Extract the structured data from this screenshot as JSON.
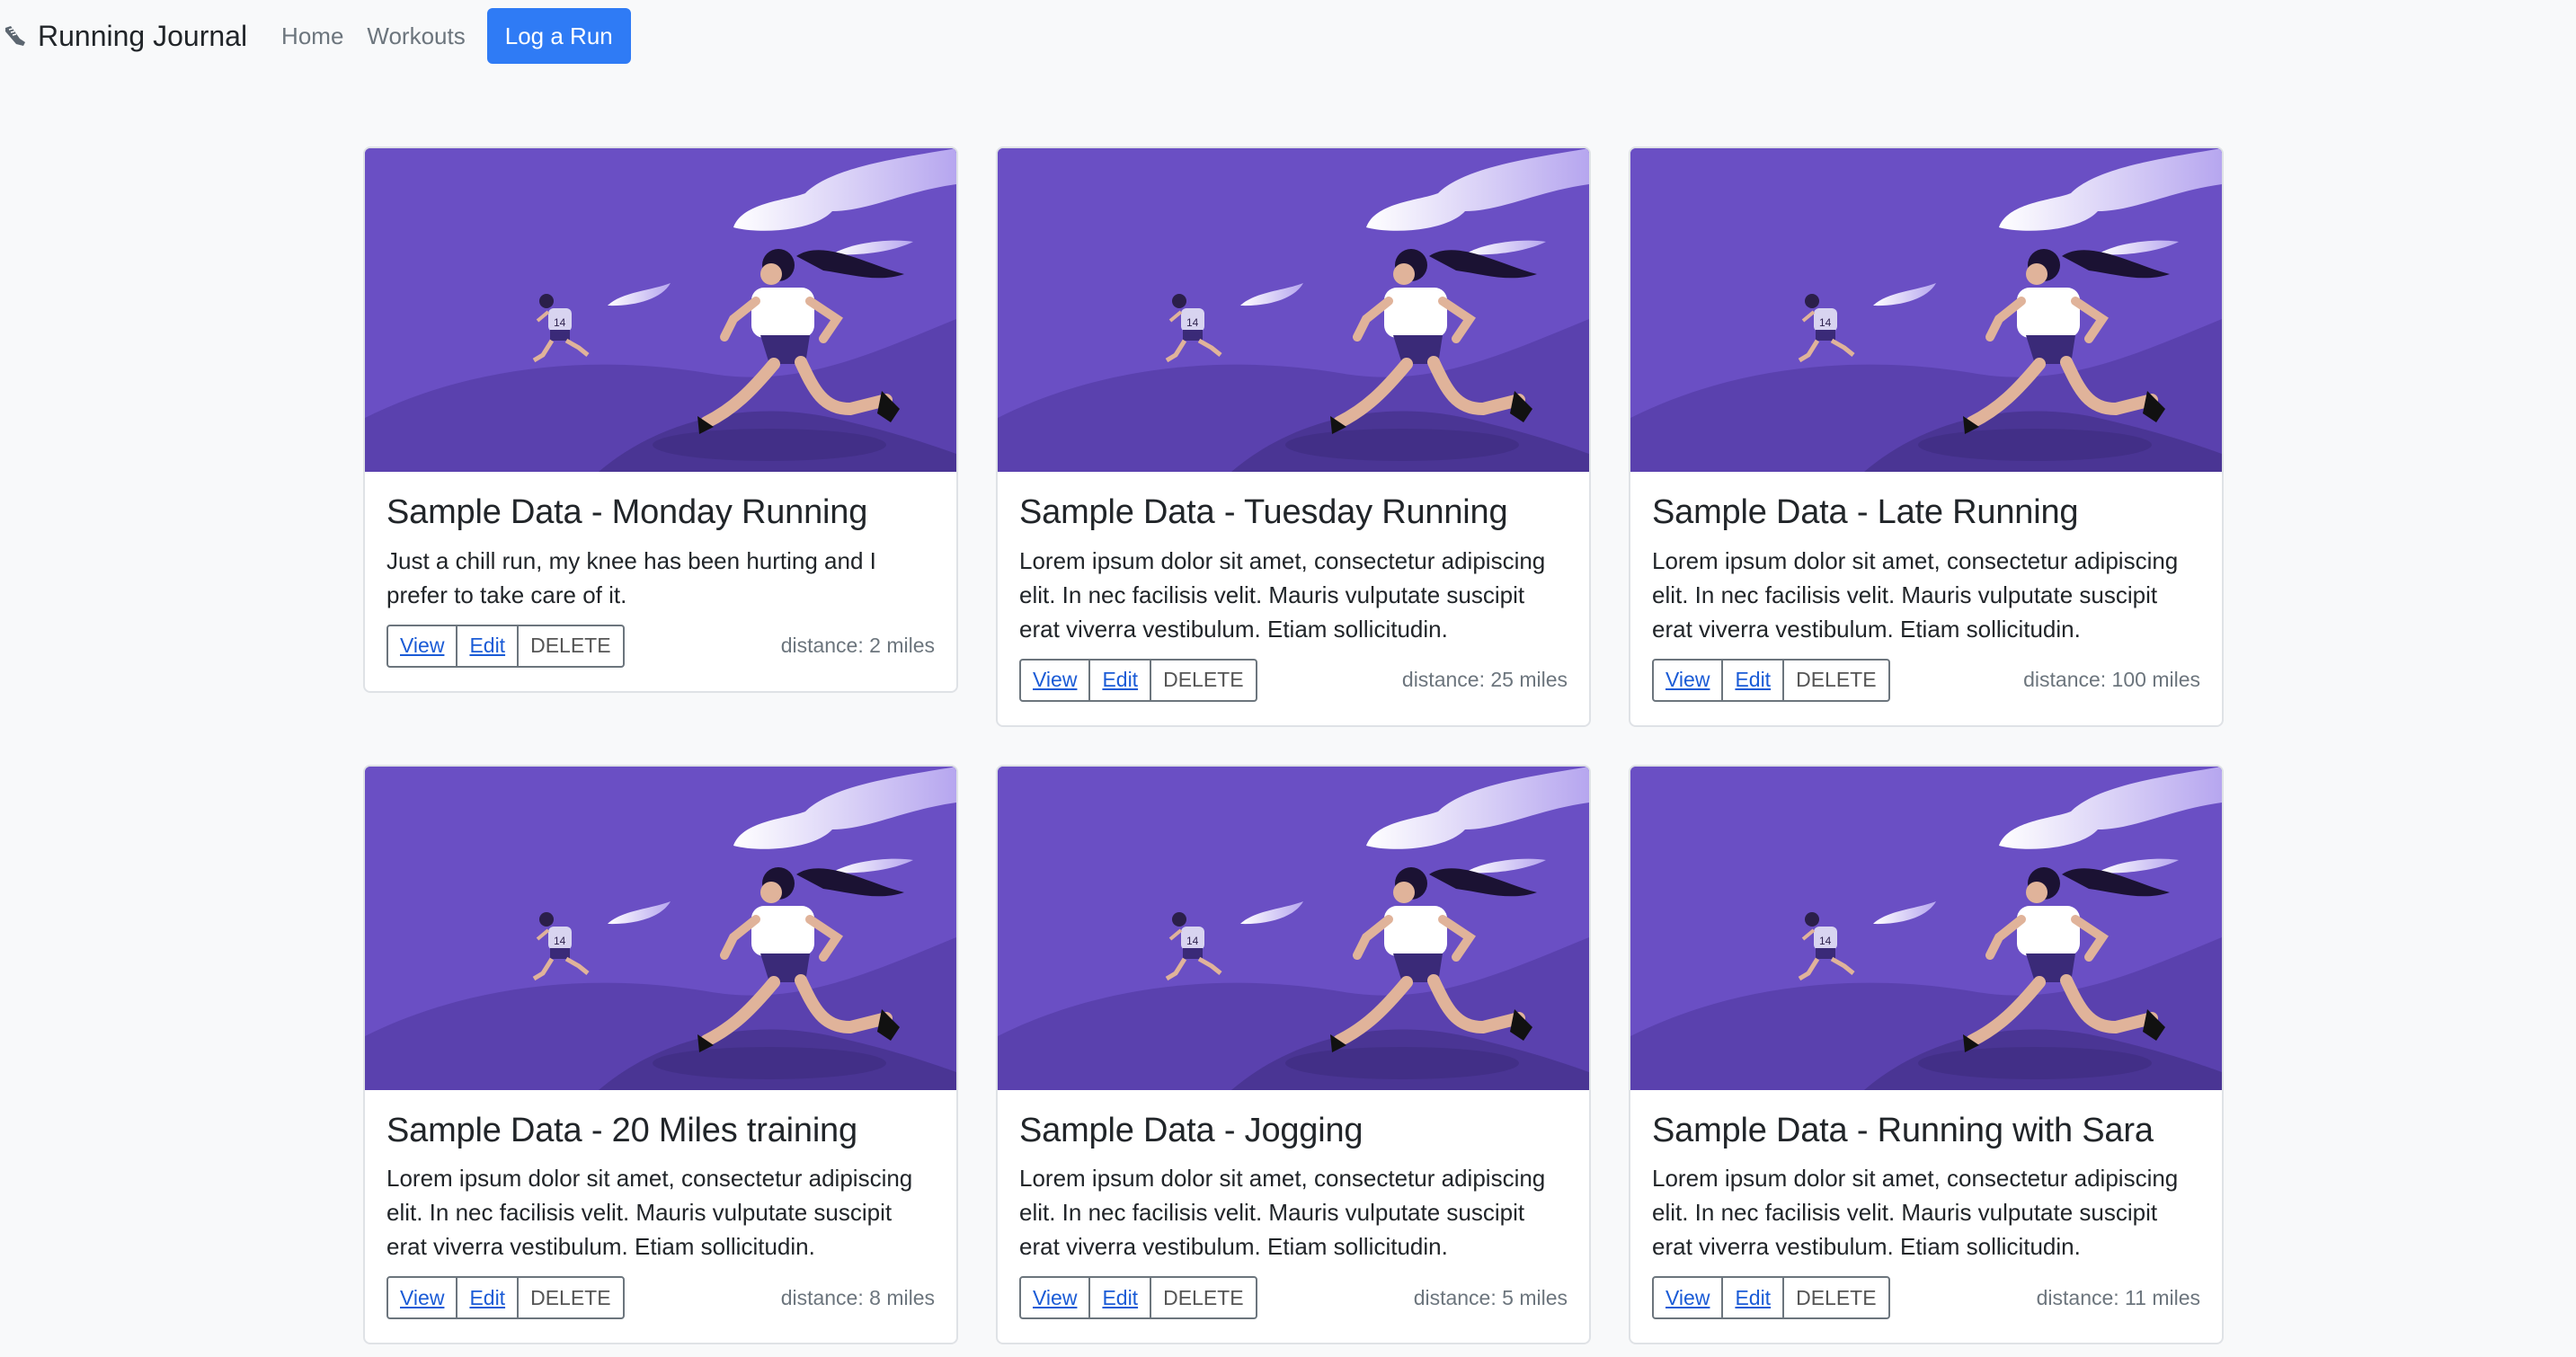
{
  "nav": {
    "brand": "Running Journal",
    "links": [
      "Home",
      "Workouts"
    ],
    "cta": "Log a Run"
  },
  "colors": {
    "primary": "#2f7bf5",
    "card_image_bg": "#6a4fc4",
    "link": "#1a5bd6"
  },
  "cards": [
    {
      "title": "Sample Data - Monday Running",
      "text": "Just a chill run, my knee has been hurting and I prefer to take care of it.",
      "view": "View",
      "edit": "Edit",
      "delete": "DELETE",
      "distance": "distance: 2 miles"
    },
    {
      "title": "Sample Data - Tuesday Running",
      "text": "Lorem ipsum dolor sit amet, consectetur adipiscing elit. In nec facilisis velit. Mauris vulputate suscipit erat viverra vestibulum. Etiam sollicitudin.",
      "view": "View",
      "edit": "Edit",
      "delete": "DELETE",
      "distance": "distance: 25 miles"
    },
    {
      "title": "Sample Data - Late Running",
      "text": "Lorem ipsum dolor sit amet, consectetur adipiscing elit. In nec facilisis velit. Mauris vulputate suscipit erat viverra vestibulum. Etiam sollicitudin.",
      "view": "View",
      "edit": "Edit",
      "delete": "DELETE",
      "distance": "distance: 100 miles"
    },
    {
      "title": "Sample Data - 20 Miles training",
      "text": "Lorem ipsum dolor sit amet, consectetur adipiscing elit. In nec facilisis velit. Mauris vulputate suscipit erat viverra vestibulum. Etiam sollicitudin.",
      "view": "View",
      "edit": "Edit",
      "delete": "DELETE",
      "distance": "distance: 8 miles"
    },
    {
      "title": "Sample Data - Jogging",
      "text": "Lorem ipsum dolor sit amet, consectetur adipiscing elit. In nec facilisis velit. Mauris vulputate suscipit erat viverra vestibulum. Etiam sollicitudin.",
      "view": "View",
      "edit": "Edit",
      "delete": "DELETE",
      "distance": "distance: 5 miles"
    },
    {
      "title": "Sample Data - Running with Sara",
      "text": "Lorem ipsum dolor sit amet, consectetur adipiscing elit. In nec facilisis velit. Mauris vulputate suscipit erat viverra vestibulum. Etiam sollicitudin.",
      "view": "View",
      "edit": "Edit",
      "delete": "DELETE",
      "distance": "distance: 11 miles"
    }
  ]
}
